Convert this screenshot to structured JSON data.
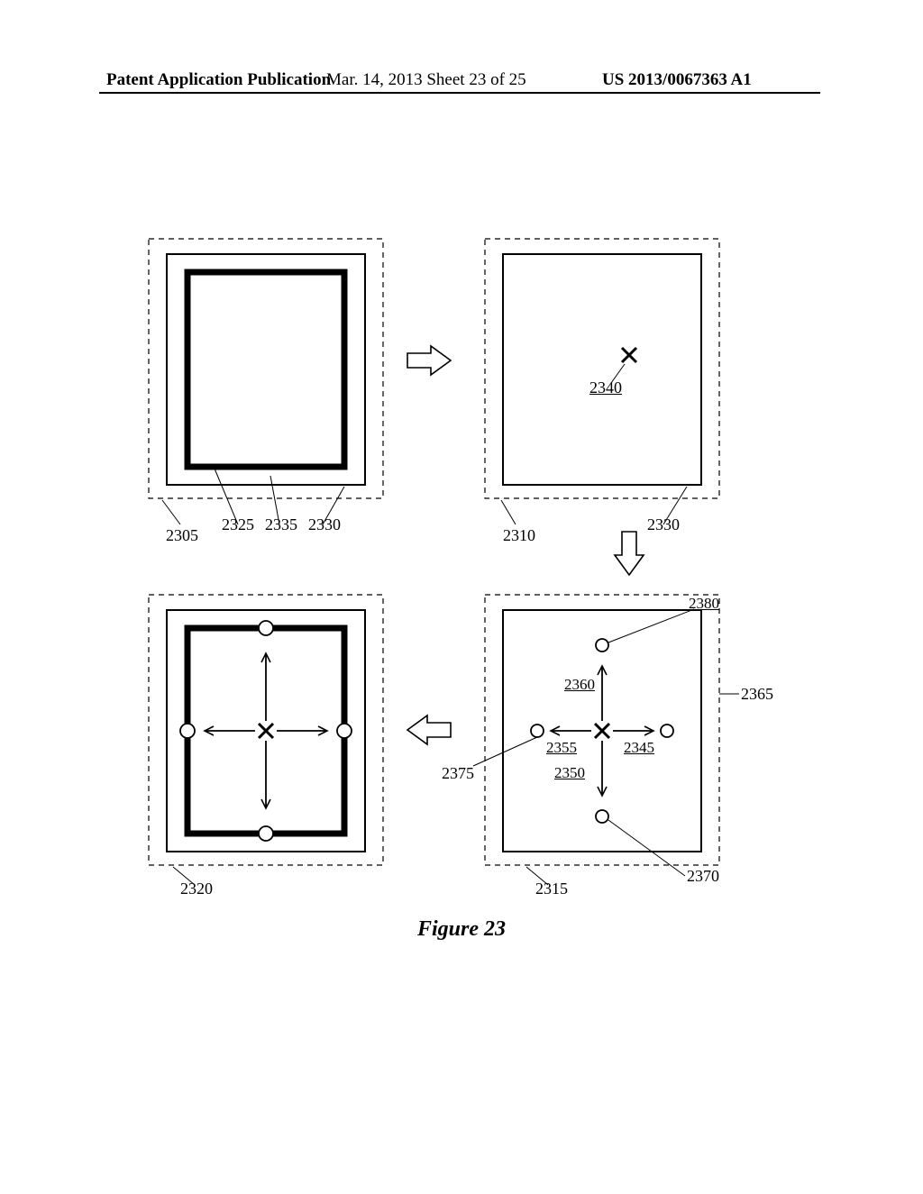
{
  "header": {
    "left": "Patent Application Publication",
    "center": "Mar. 14, 2013  Sheet 23 of 25",
    "right": "US 2013/0067363 A1"
  },
  "figure": {
    "caption": "Figure 23",
    "panels": {
      "tl": {
        "label_stage": "2305",
        "labels": [
          "2325",
          "2335",
          "2330"
        ]
      },
      "tr": {
        "label_stage": "2310",
        "label_right": "2330",
        "x_label": "2340"
      },
      "bl": {
        "label_stage": "2320"
      },
      "br": {
        "label_stage": "2315",
        "refs": {
          "x_ref": "2345",
          "down_arrow": "2350",
          "left_arrow": "2355",
          "up_arrow": "2360",
          "right_callout": "2365",
          "bottom_circle": "2370",
          "left_callout": "2375",
          "top_circle": "2380"
        }
      }
    }
  }
}
